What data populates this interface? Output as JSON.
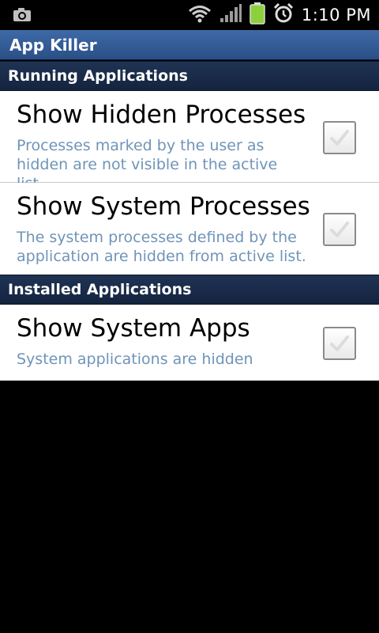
{
  "status_bar": {
    "time": "1:10 PM",
    "icons": [
      "camera-icon",
      "wifi-icon",
      "signal-icon",
      "battery-icon",
      "alarm-icon"
    ]
  },
  "app": {
    "title": "App Killer"
  },
  "sections": [
    {
      "header": "Running Applications",
      "items": [
        {
          "title": "Show Hidden Processes",
          "summary": "Processes marked by the user as hidden are not visible in the active list.",
          "checked": false
        },
        {
          "title": "Show System Processes",
          "summary": "The system processes defined by the application are hidden from active list.",
          "checked": false
        }
      ]
    },
    {
      "header": "Installed Applications",
      "items": [
        {
          "title": "Show System Apps",
          "summary": "System applications are hidden",
          "checked": false
        }
      ]
    }
  ],
  "colors": {
    "title_bar": "#2f5a94",
    "section_header": "#1a2c4a",
    "summary_text": "#6f94b9",
    "battery": "#8cd13c"
  }
}
